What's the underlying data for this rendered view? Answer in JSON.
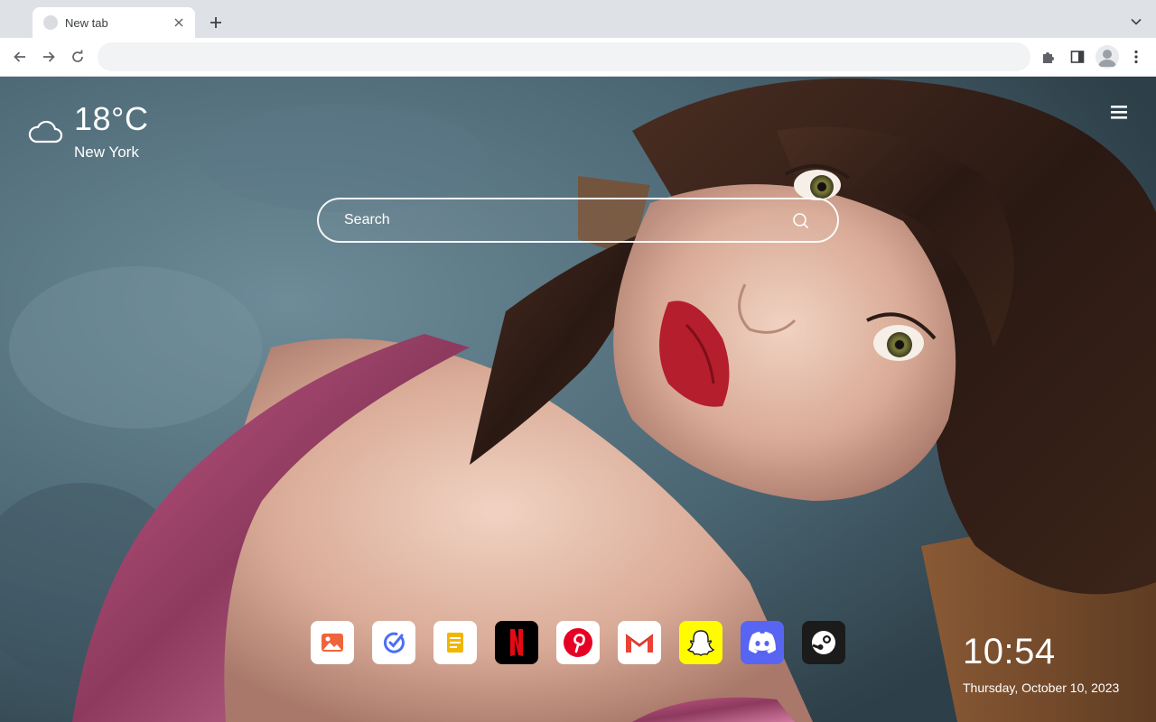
{
  "browser": {
    "tab": {
      "title": "New tab",
      "close_icon": "close-icon"
    },
    "new_tab_icon": "plus-icon",
    "tab_search_icon": "chevron-down-icon",
    "toolbar": {
      "back_icon": "arrow-left-icon",
      "forward_icon": "arrow-right-icon",
      "reload_icon": "reload-icon",
      "omnibox_value": "",
      "extensions_icon": "puzzle-icon",
      "side_panel_icon": "side-panel-icon",
      "profile_icon": "avatar-icon",
      "menu_icon": "kebab-menu-icon"
    }
  },
  "newtab": {
    "weather": {
      "temperature": "18°C",
      "city": "New York",
      "icon": "cloud-icon"
    },
    "menu_icon": "hamburger-icon",
    "search": {
      "placeholder": "Search",
      "value": "",
      "icon": "search-icon"
    },
    "shortcuts": [
      {
        "name": "Photos",
        "icon": "image-icon",
        "bg": "#ffffff",
        "accent": "#f0643c"
      },
      {
        "name": "Tasks",
        "icon": "check-circle-icon",
        "bg": "#ffffff",
        "accent": "#4c6ef5"
      },
      {
        "name": "Notes",
        "icon": "note-icon",
        "bg": "#ffffff",
        "accent": "#f2b600"
      },
      {
        "name": "Netflix",
        "icon": "netflix-icon",
        "bg": "#000000",
        "accent": "#e50914"
      },
      {
        "name": "Pinterest",
        "icon": "pinterest-icon",
        "bg": "#ffffff",
        "accent": "#e60023"
      },
      {
        "name": "Gmail",
        "icon": "gmail-icon",
        "bg": "#ffffff",
        "accent": "#ea4335"
      },
      {
        "name": "Snapchat",
        "icon": "snapchat-icon",
        "bg": "#fffc00",
        "accent": "#ffffff"
      },
      {
        "name": "Discord",
        "icon": "discord-icon",
        "bg": "#5865f2",
        "accent": "#ffffff"
      },
      {
        "name": "Steam",
        "icon": "steam-icon",
        "bg": "#1b1b1b",
        "accent": "#ffffff"
      }
    ],
    "clock": {
      "time": "10:54",
      "date": "Thursday, October 10, 2023"
    }
  }
}
